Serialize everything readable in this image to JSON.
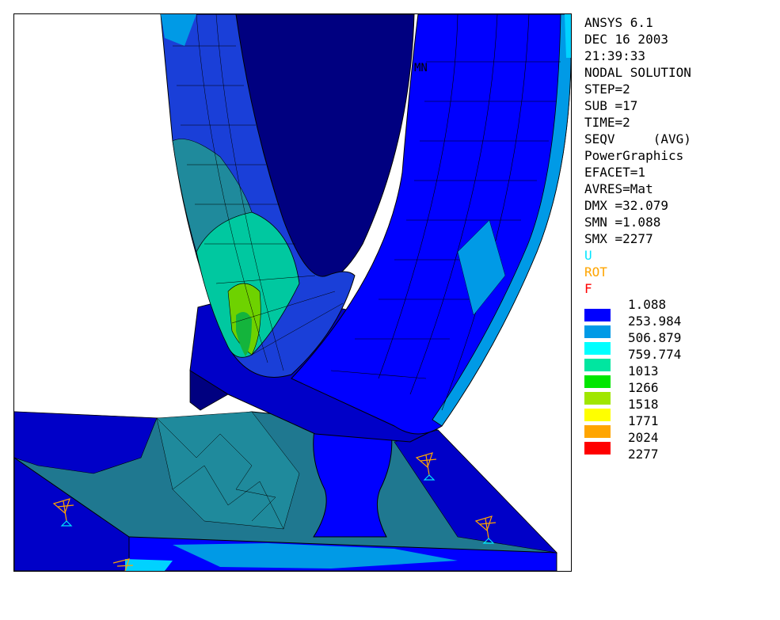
{
  "app": {
    "title": "ANSYS 6.1"
  },
  "header_lines": [
    {
      "text": "ANSYS 6.1",
      "color": "#000000"
    },
    {
      "text": "DEC 16 2003",
      "color": "#000000"
    },
    {
      "text": "21:39:33",
      "color": "#000000"
    },
    {
      "text": "NODAL SOLUTION",
      "color": "#000000"
    },
    {
      "text": "STEP=2",
      "color": "#000000"
    },
    {
      "text": "SUB =17",
      "color": "#000000"
    },
    {
      "text": "TIME=2",
      "color": "#000000"
    },
    {
      "text": "SEQV     (AVG)",
      "color": "#000000"
    },
    {
      "text": "PowerGraphics",
      "color": "#000000"
    },
    {
      "text": "EFACET=1",
      "color": "#000000"
    },
    {
      "text": "AVRES=Mat",
      "color": "#000000"
    },
    {
      "text": "DMX =32.079",
      "color": "#000000"
    },
    {
      "text": "SMN =1.088",
      "color": "#000000"
    },
    {
      "text": "SMX =2277",
      "color": "#000000"
    },
    {
      "text": "U",
      "color": "#00e5ff"
    },
    {
      "text": "ROT",
      "color": "#ffa500"
    },
    {
      "text": "F",
      "color": "#ff0000"
    }
  ],
  "plot_label": "MN",
  "legend": {
    "values": [
      "1.088",
      "253.984",
      "506.879",
      "759.774",
      "1013",
      "1266",
      "1518",
      "1771",
      "2024",
      "2277"
    ],
    "colors": [
      "#0000ff",
      "#009ae6",
      "#00ffff",
      "#00e6a0",
      "#00e600",
      "#a0e600",
      "#ffff00",
      "#ffa500",
      "#ff0000"
    ]
  },
  "palette": {
    "dark_navy": "#000080",
    "navy": "#0000c8",
    "blue": "#0000ff",
    "mid_blue": "#1a3fd8",
    "teal_dark": "#006e8c",
    "teal": "#1f8a9c",
    "light_blue": "#009ae6",
    "cyan": "#00d2ff",
    "green_teal": "#00c8a0",
    "green": "#14b43c",
    "lime": "#6ed200"
  }
}
